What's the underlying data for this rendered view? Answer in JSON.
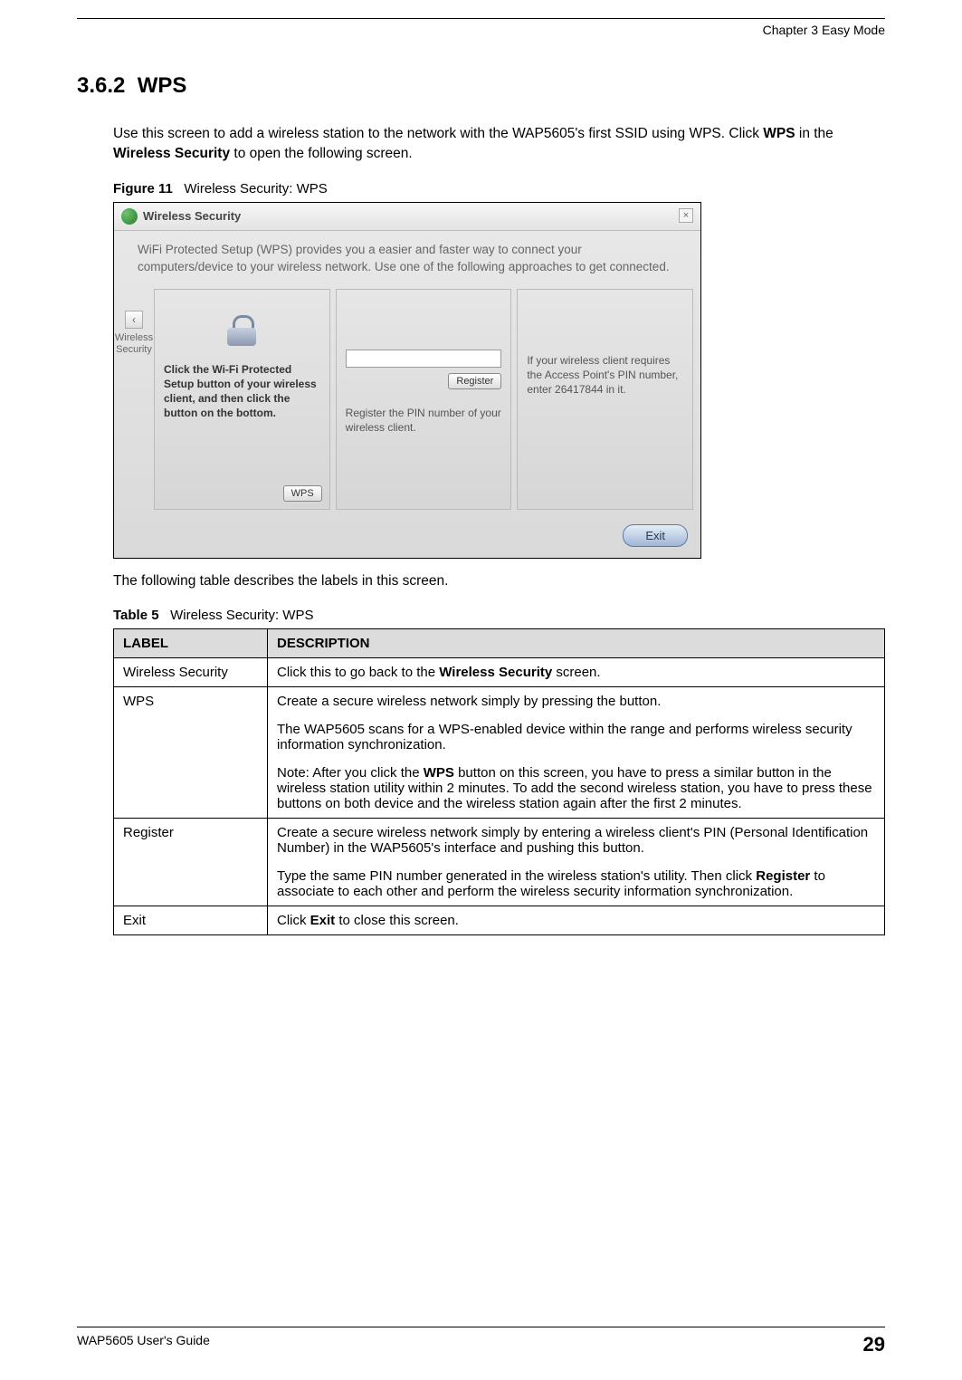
{
  "header": {
    "chapter": "Chapter 3 Easy Mode"
  },
  "section": {
    "number": "3.6.2",
    "title": "WPS"
  },
  "intro": {
    "p1a": "Use this screen to add a wireless station to the network with the WAP5605's first SSID using WPS. Click ",
    "p1_bold1": "WPS",
    "p1b": " in the ",
    "p1_bold2": "Wireless Security",
    "p1c": " to open the following screen."
  },
  "figure": {
    "label": "Figure 11",
    "caption": "Wireless Security: WPS",
    "titlebar": "Wireless Security",
    "close": "×",
    "introText": "WiFi Protected Setup (WPS) provides you a easier and faster way to connect your computers/device to your wireless network. Use one of the following approaches to get connected.",
    "leftTab": {
      "chev": "‹",
      "l1": "Wireless",
      "l2": "Security"
    },
    "panel1": {
      "textA": "Click the Wi-Fi Protected Setup button of your wireless client, and then click the button on the bottom.",
      "btn": "WPS"
    },
    "panel2": {
      "btn": "Register",
      "caption": "Register the PIN number of your wireless client."
    },
    "panel3": {
      "text": "If your wireless client requires the Access Point's PIN number, enter 26417844 in it."
    },
    "exit": "Exit"
  },
  "afterFigure": "The following table describes the labels in this screen.",
  "table": {
    "label": "Table 5",
    "caption": "Wireless Security: WPS",
    "headers": {
      "c1": "LABEL",
      "c2": "DESCRIPTION"
    },
    "rows": [
      {
        "label": "Wireless Security",
        "desc_a": "Click this to go back to the ",
        "desc_bold": "Wireless Security",
        "desc_b": " screen."
      },
      {
        "label": "WPS",
        "p1": "Create a secure wireless network simply by pressing the button.",
        "p2": "The WAP5605 scans for a WPS-enabled device within the range and performs wireless security information synchronization.",
        "note_a": "Note: After you click the ",
        "note_bold": "WPS",
        "note_b": " button on this screen, you have to press a similar button in the wireless station utility within 2 minutes. To add the second wireless station, you have to press these buttons on both device and the wireless station again after the first 2 minutes."
      },
      {
        "label": "Register",
        "p1": "Create a secure wireless network simply by entering a wireless client's PIN (Personal Identification Number) in the WAP5605's interface and pushing this button.",
        "p2a": "Type the same PIN number generated in the wireless station's utility. Then click ",
        "p2_bold": "Register",
        "p2b": " to associate to each other and perform the wireless security information synchronization."
      },
      {
        "label": "Exit",
        "desc_a": "Click ",
        "desc_bold": "Exit",
        "desc_b": " to close this screen."
      }
    ]
  },
  "footer": {
    "guide": "WAP5605 User's Guide",
    "page": "29"
  }
}
